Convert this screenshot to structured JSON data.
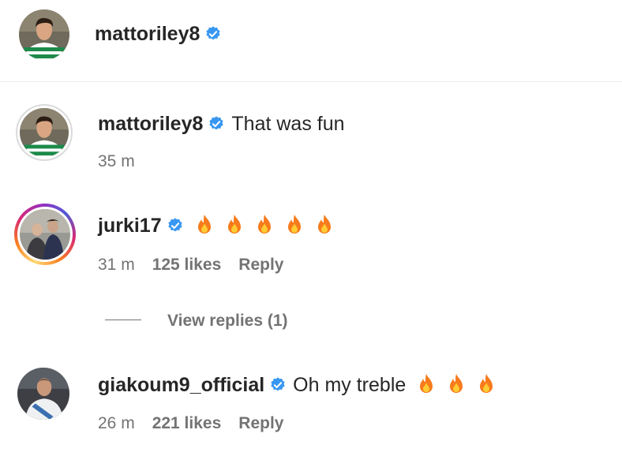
{
  "header": {
    "username": "mattoriley8",
    "verified": true,
    "avatar": "footballer-green-white-hoops-avatar"
  },
  "comments": [
    {
      "username": "mattoriley8",
      "verified": true,
      "text": "That was fun",
      "emojis": [],
      "time": "35 m",
      "likes": "",
      "reply_label": "",
      "avatar": "footballer-green-white-hoops-avatar"
    },
    {
      "username": "jurki17",
      "verified": true,
      "text": "",
      "emojis": [
        "fire",
        "fire",
        "fire",
        "fire",
        "fire"
      ],
      "time": "31 m",
      "likes": "125 likes",
      "reply_label": "Reply",
      "avatar": "two-people-story-avatar",
      "view_replies": "View replies (1)"
    },
    {
      "username": "giakoum9_official",
      "verified": true,
      "text": "Oh my treble",
      "emojis": [
        "fire",
        "fire",
        "fire"
      ],
      "time": "26 m",
      "likes": "221 likes",
      "reply_label": "Reply",
      "avatar": "footballer-white-kit-avatar"
    }
  ],
  "colors": {
    "verified": "#3897f0",
    "muted": "#737373",
    "text": "#262626",
    "fire_outer": "#f77b1c",
    "fire_inner": "#ffcc33"
  }
}
